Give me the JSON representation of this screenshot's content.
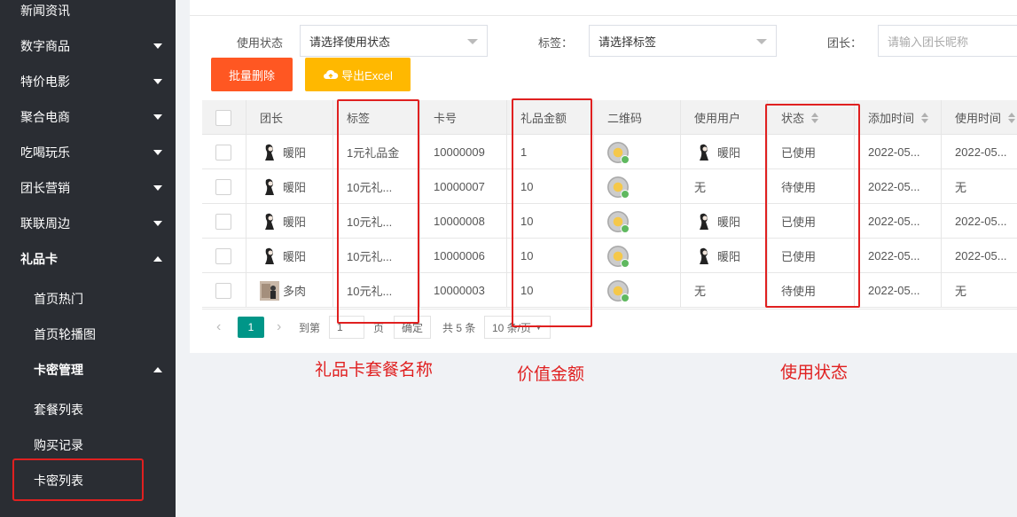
{
  "sidebar": {
    "items": [
      {
        "label": "新闻资讯",
        "expand": ""
      },
      {
        "label": "数字商品",
        "expand": "down"
      },
      {
        "label": "特价电影",
        "expand": "down"
      },
      {
        "label": "聚合电商",
        "expand": "down"
      },
      {
        "label": "吃喝玩乐",
        "expand": "down"
      },
      {
        "label": "团长营销",
        "expand": "down"
      },
      {
        "label": "联联周边",
        "expand": "down"
      },
      {
        "label": "礼品卡",
        "expand": "up"
      }
    ],
    "sub_items": [
      "首页热门",
      "首页轮播图"
    ],
    "group": {
      "label": "卡密管理"
    },
    "group_items": [
      "套餐列表",
      "购买记录",
      "卡密列表"
    ]
  },
  "filters": {
    "status_label": "使用状态",
    "status_placeholder": "请选择使用状态",
    "tag_label": "标签：",
    "tag_placeholder": "请选择标签",
    "leader_label": "团长：",
    "leader_placeholder": "请输入团长昵称"
  },
  "buttons": {
    "batch_delete": "批量删除",
    "export": "导出Excel"
  },
  "table": {
    "headers": [
      "团长",
      "标签",
      "卡号",
      "礼品金额",
      "二维码",
      "使用用户",
      "状态",
      "添加时间",
      "使用时间"
    ],
    "rows": [
      {
        "leader": "暖阳",
        "tag": "1元礼品金",
        "card": "10000009",
        "amount": "1",
        "user": "暖阳",
        "status": "已使用",
        "added": "2022-05...",
        "used": "2022-05..."
      },
      {
        "leader": "暖阳",
        "tag": "10元礼...",
        "card": "10000007",
        "amount": "10",
        "user": "无",
        "status": "待使用",
        "added": "2022-05...",
        "used": "无"
      },
      {
        "leader": "暖阳",
        "tag": "10元礼...",
        "card": "10000008",
        "amount": "10",
        "user": "暖阳",
        "status": "已使用",
        "added": "2022-05...",
        "used": "2022-05..."
      },
      {
        "leader": "暖阳",
        "tag": "10元礼...",
        "card": "10000006",
        "amount": "10",
        "user": "暖阳",
        "status": "已使用",
        "added": "2022-05...",
        "used": "2022-05..."
      },
      {
        "leader": "多肉",
        "tag": "10元礼...",
        "card": "10000003",
        "amount": "10",
        "user": "无",
        "status": "待使用",
        "added": "2022-05...",
        "used": "无"
      }
    ]
  },
  "pager": {
    "current": "1",
    "goto_label": "到第",
    "goto_value": "1",
    "page_unit": "页",
    "confirm": "确定",
    "total": "共 5 条",
    "page_size": "10 条/页"
  },
  "annotations": {
    "tag_note": "礼品卡套餐名称",
    "amount_note": "价值金额",
    "status_note": "使用状态"
  },
  "colors": {
    "sidebar_bg": "#2a2d33",
    "delete_btn": "#ff5722",
    "export_btn": "#ffb800",
    "page_active": "#009688",
    "annotation": "#e02020"
  }
}
